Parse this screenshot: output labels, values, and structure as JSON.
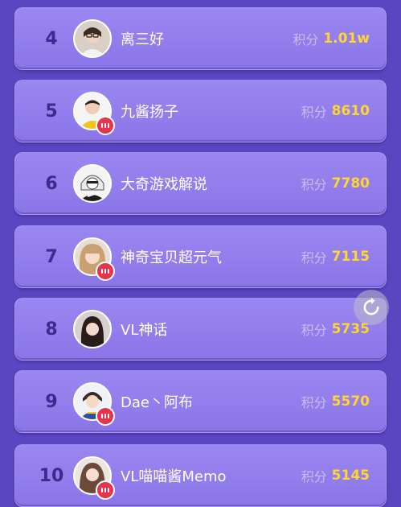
{
  "colors": {
    "background": "#5b46c2",
    "card": "#9b87f0",
    "rank_text": "#3e2a8c",
    "score_value": "#ffd630",
    "live_badge": "#e8334e"
  },
  "ranking": [
    {
      "rank": "4",
      "name": "离三好",
      "score_label": "积分",
      "score": "1.01w",
      "live": false,
      "avatar": "avatar-girl-glasses"
    },
    {
      "rank": "5",
      "name": "九酱扬子",
      "score_label": "积分",
      "score": "8610",
      "live": true,
      "avatar": "avatar-boy-yellow"
    },
    {
      "rank": "6",
      "name": "大奇游戏解说",
      "score_label": "积分",
      "score": "7780",
      "live": false,
      "avatar": "avatar-cartoon-hoodie"
    },
    {
      "rank": "7",
      "name": "神奇宝贝超元气",
      "score_label": "积分",
      "score": "7115",
      "live": true,
      "avatar": "avatar-girl-blonde"
    },
    {
      "rank": "8",
      "name": "VL神话",
      "score_label": "积分",
      "score": "5735",
      "live": false,
      "avatar": "avatar-girl-dark"
    },
    {
      "rank": "9",
      "name": "Dae丶阿布",
      "score_label": "积分",
      "score": "5570",
      "live": true,
      "avatar": "avatar-cartoon-boy"
    },
    {
      "rank": "10",
      "name": "VL喵喵酱Memo",
      "score_label": "积分",
      "score": "5145",
      "live": true,
      "avatar": "avatar-girl-long-hair"
    }
  ],
  "floating_button": {
    "icon": "refresh-icon"
  }
}
